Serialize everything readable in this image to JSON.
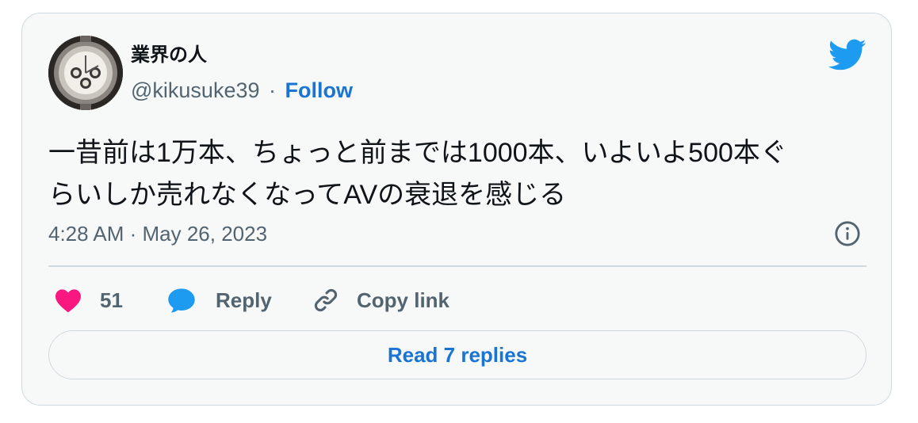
{
  "author": {
    "display_name": "業界の人",
    "handle": "@kikusuke39",
    "separator": "·",
    "follow_label": "Follow"
  },
  "tweet": {
    "text_line1": "一昔前は1万本、ちょっと前までは1000本、いよいよ500本ぐ",
    "text_line2": "らいしか売れなくなってAVの衰退を感じる",
    "timestamp": "4:28 AM · May 26, 2023"
  },
  "actions": {
    "like_count": "51",
    "reply_label": "Reply",
    "copy_link_label": "Copy link",
    "read_replies_label": "Read 7 replies"
  },
  "icons": {
    "brand": "twitter-bird-icon",
    "info": "info-icon",
    "like": "heart-icon",
    "reply": "speech-bubble-icon",
    "copy": "link-icon"
  },
  "colors": {
    "brand_blue": "#1d9bf0",
    "link_blue": "#1a74d4",
    "like_pink": "#f91880",
    "muted_text": "#536471",
    "card_background": "#f7f9f9"
  }
}
